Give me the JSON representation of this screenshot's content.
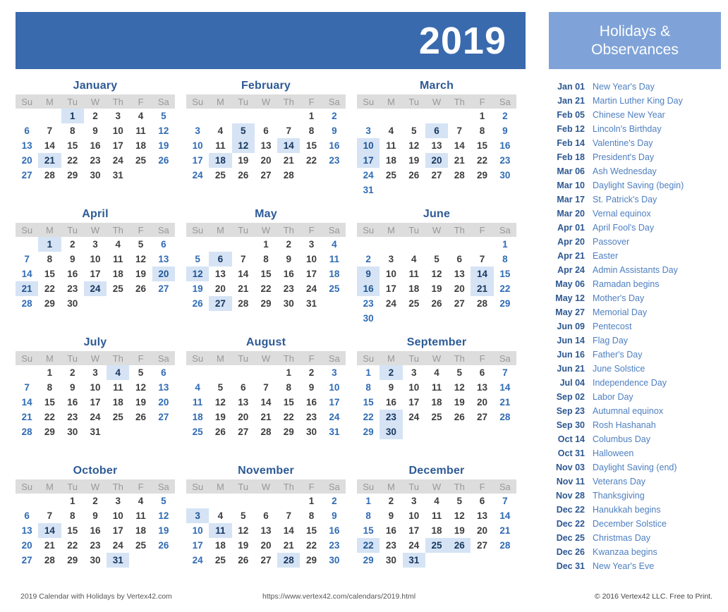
{
  "header": {
    "year": "2019"
  },
  "sidebar": {
    "title": "Holidays & Observances",
    "title_line1": "Holidays &",
    "title_line2": "Observances",
    "holidays": [
      {
        "date": "Jan 01",
        "name": "New Year's Day"
      },
      {
        "date": "Jan 21",
        "name": "Martin Luther King Day"
      },
      {
        "date": "Feb 05",
        "name": "Chinese New Year"
      },
      {
        "date": "Feb 12",
        "name": "Lincoln's Birthday"
      },
      {
        "date": "Feb 14",
        "name": "Valentine's Day"
      },
      {
        "date": "Feb 18",
        "name": "President's Day"
      },
      {
        "date": "Mar 06",
        "name": "Ash Wednesday"
      },
      {
        "date": "Mar 10",
        "name": "Daylight Saving (begin)"
      },
      {
        "date": "Mar 17",
        "name": "St. Patrick's Day"
      },
      {
        "date": "Mar 20",
        "name": "Vernal equinox"
      },
      {
        "date": "Apr 01",
        "name": "April Fool's Day"
      },
      {
        "date": "Apr 20",
        "name": "Passover"
      },
      {
        "date": "Apr 21",
        "name": "Easter"
      },
      {
        "date": "Apr 24",
        "name": "Admin Assistants Day"
      },
      {
        "date": "May 06",
        "name": "Ramadan begins"
      },
      {
        "date": "May 12",
        "name": "Mother's Day"
      },
      {
        "date": "May 27",
        "name": "Memorial Day"
      },
      {
        "date": "Jun 09",
        "name": "Pentecost"
      },
      {
        "date": "Jun 14",
        "name": "Flag Day"
      },
      {
        "date": "Jun 16",
        "name": "Father's Day"
      },
      {
        "date": "Jun 21",
        "name": "June Solstice"
      },
      {
        "date": "Jul 04",
        "name": "Independence Day"
      },
      {
        "date": "Sep 02",
        "name": "Labor Day"
      },
      {
        "date": "Sep 23",
        "name": "Autumnal equinox"
      },
      {
        "date": "Sep 30",
        "name": "Rosh Hashanah"
      },
      {
        "date": "Oct 14",
        "name": "Columbus Day"
      },
      {
        "date": "Oct 31",
        "name": "Halloween"
      },
      {
        "date": "Nov 03",
        "name": "Daylight Saving (end)"
      },
      {
        "date": "Nov 11",
        "name": "Veterans Day"
      },
      {
        "date": "Nov 28",
        "name": "Thanksgiving"
      },
      {
        "date": "Dec 22",
        "name": "Hanukkah begins"
      },
      {
        "date": "Dec 22",
        "name": "December Solstice"
      },
      {
        "date": "Dec 25",
        "name": "Christmas Day"
      },
      {
        "date": "Dec 26",
        "name": "Kwanzaa begins"
      },
      {
        "date": "Dec 31",
        "name": "New Year's Eve"
      }
    ]
  },
  "calendar": {
    "weekday_headers": [
      "Su",
      "M",
      "Tu",
      "W",
      "Th",
      "F",
      "Sa"
    ],
    "months": [
      {
        "name": "January",
        "first_weekday": 2,
        "days": 31,
        "highlights": [
          1,
          21
        ]
      },
      {
        "name": "February",
        "first_weekday": 5,
        "days": 28,
        "highlights": [
          5,
          12,
          14,
          18
        ]
      },
      {
        "name": "March",
        "first_weekday": 5,
        "days": 31,
        "highlights": [
          6,
          10,
          17,
          20
        ]
      },
      {
        "name": "April",
        "first_weekday": 1,
        "days": 30,
        "highlights": [
          1,
          20,
          21,
          24
        ]
      },
      {
        "name": "May",
        "first_weekday": 3,
        "days": 31,
        "highlights": [
          6,
          12,
          27
        ]
      },
      {
        "name": "June",
        "first_weekday": 6,
        "days": 30,
        "highlights": [
          9,
          14,
          16,
          21
        ]
      },
      {
        "name": "July",
        "first_weekday": 1,
        "days": 31,
        "highlights": [
          4
        ]
      },
      {
        "name": "August",
        "first_weekday": 4,
        "days": 31,
        "highlights": []
      },
      {
        "name": "September",
        "first_weekday": 0,
        "days": 30,
        "highlights": [
          2,
          23,
          30
        ]
      },
      {
        "name": "October",
        "first_weekday": 2,
        "days": 31,
        "highlights": [
          14,
          31
        ]
      },
      {
        "name": "November",
        "first_weekday": 5,
        "days": 30,
        "highlights": [
          3,
          11,
          28
        ]
      },
      {
        "name": "December",
        "first_weekday": 0,
        "days": 31,
        "highlights": [
          22,
          25,
          26,
          31
        ]
      }
    ]
  },
  "footer": {
    "left": "2019 Calendar with Holidays by Vertex42.com",
    "center": "https://www.vertex42.com/calendars/2019.html",
    "right": "© 2016 Vertex42 LLC. Free to Print."
  },
  "colors": {
    "header_blue": "#3a6aae",
    "sidebar_blue": "#7fa3d8",
    "month_title": "#2d5a96",
    "weekday_bar": "#dddddd",
    "weekday_text": "#989898",
    "weekend_text": "#2f6bb5",
    "weekday_num": "#3d3d3d",
    "highlight_bg": "#d5e3f5",
    "holiday_date": "#2c5791",
    "holiday_name": "#4d7fc0"
  }
}
